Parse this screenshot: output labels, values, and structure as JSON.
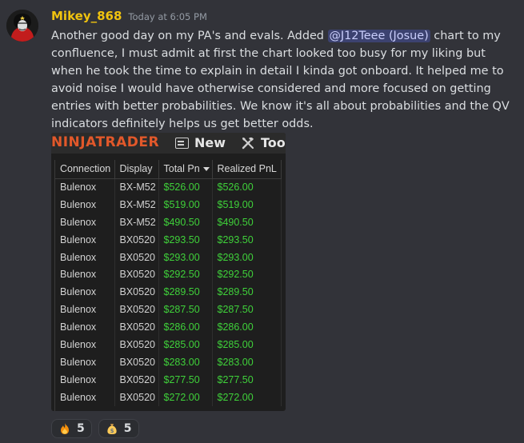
{
  "message": {
    "username": "Mikey_868",
    "timestamp": "Today at 6:05 PM",
    "text_part1": "Another good day on my PA's and evals. Added ",
    "mention": "@J12Teee (Josue)",
    "text_part2": "  chart to my confluence, I must admit at first the chart looked too busy for my liking but when he took the time to explain in detail I kinda got onboard. It helped me to avoid noise I would have otherwise considered and more focused on getting entries with better probabilities. We know it's all about probabilities and the QV indicators definitely helps us get better odds."
  },
  "attachment": {
    "logo": "NINJATRADER",
    "toolbar": {
      "new_label": "New",
      "tools_label": "Tool",
      "new_icon": "new-window-icon",
      "tools_icon": "tools-icon"
    },
    "colors": {
      "logo": "#e2582a",
      "profit": "#3fd13a"
    },
    "columns": [
      "Connection",
      "Display",
      "Total Pn",
      "Realized PnL"
    ],
    "rows": [
      [
        "Bulenox",
        "BX-M52",
        "$526.00",
        "$526.00"
      ],
      [
        "Bulenox",
        "BX-M52",
        "$519.00",
        "$519.00"
      ],
      [
        "Bulenox",
        "BX-M52",
        "$490.50",
        "$490.50"
      ],
      [
        "Bulenox",
        "BX0520",
        "$293.50",
        "$293.50"
      ],
      [
        "Bulenox",
        "BX0520",
        "$293.00",
        "$293.00"
      ],
      [
        "Bulenox",
        "BX0520",
        "$292.50",
        "$292.50"
      ],
      [
        "Bulenox",
        "BX0520",
        "$289.50",
        "$289.50"
      ],
      [
        "Bulenox",
        "BX0520",
        "$287.50",
        "$287.50"
      ],
      [
        "Bulenox",
        "BX0520",
        "$286.00",
        "$286.00"
      ],
      [
        "Bulenox",
        "BX0520",
        "$285.00",
        "$285.00"
      ],
      [
        "Bulenox",
        "BX0520",
        "$283.00",
        "$283.00"
      ],
      [
        "Bulenox",
        "BX0520",
        "$277.50",
        "$277.50"
      ],
      [
        "Bulenox",
        "BX0520",
        "$272.00",
        "$272.00"
      ]
    ]
  },
  "reactions": [
    {
      "icon": "fire-icon",
      "count": "5"
    },
    {
      "icon": "money-bag-icon",
      "count": "5"
    }
  ]
}
